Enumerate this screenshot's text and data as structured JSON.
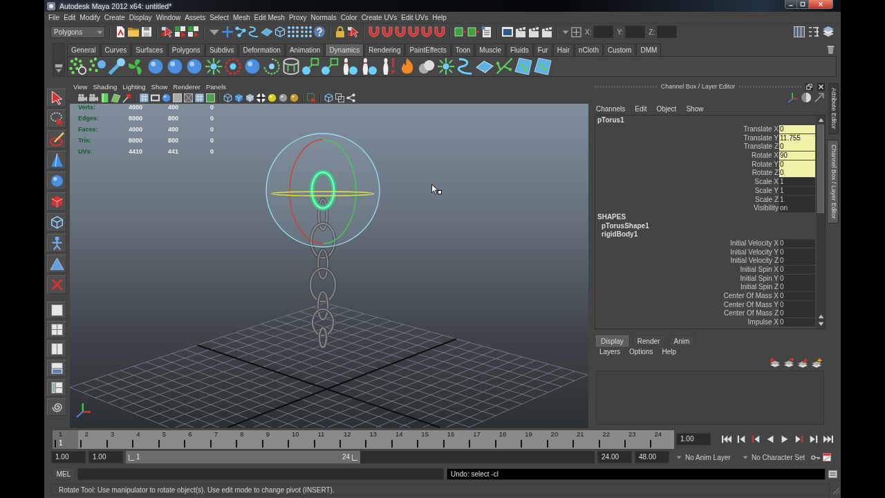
{
  "window": {
    "title": "Autodesk Maya 2012 x64: untitled*"
  },
  "menu_bar": [
    "File",
    "Edit",
    "Modify",
    "Create",
    "Display",
    "Window",
    "Assets",
    "Select",
    "Mesh",
    "Edit Mesh",
    "Proxy",
    "Normals",
    "Color",
    "Create UVs",
    "Edit UVs",
    "Help"
  ],
  "status_line": {
    "menu_set": "Polygons",
    "coordinate_fields": [
      {
        "label": "X:"
      },
      {
        "label": "Y:"
      },
      {
        "label": "Z:"
      }
    ]
  },
  "shelf": {
    "tabs": [
      {
        "label": "General",
        "selected": false
      },
      {
        "label": "Curves",
        "selected": false
      },
      {
        "label": "Surfaces",
        "selected": false
      },
      {
        "label": "Polygons",
        "selected": false
      },
      {
        "label": "Subdivs",
        "selected": false
      },
      {
        "label": "Deformation",
        "selected": false
      },
      {
        "label": "Animation",
        "selected": false
      },
      {
        "label": "Dynamics",
        "selected": true
      },
      {
        "label": "Rendering",
        "selected": false
      },
      {
        "label": "PaintEffects",
        "selected": false
      },
      {
        "label": "Toon",
        "selected": false
      },
      {
        "label": "Muscle",
        "selected": false
      },
      {
        "label": "Fluids",
        "selected": false
      },
      {
        "label": "Fur",
        "selected": false
      },
      {
        "label": "Hair",
        "selected": false
      },
      {
        "label": "nCloth",
        "selected": false
      },
      {
        "label": "Custom",
        "selected": false
      },
      {
        "label": "DMM",
        "selected": false
      }
    ]
  },
  "viewport": {
    "menus": [
      "View",
      "Shading",
      "Lighting",
      "Show",
      "Renderer",
      "Panels"
    ],
    "hud": [
      {
        "label": "Verts:",
        "values": [
          "4000",
          "400",
          "0"
        ]
      },
      {
        "label": "Edges:",
        "values": [
          "8000",
          "800",
          "0"
        ]
      },
      {
        "label": "Faces:",
        "values": [
          "4000",
          "400",
          "0"
        ]
      },
      {
        "label": "Tris:",
        "values": [
          "8000",
          "800",
          "0"
        ]
      },
      {
        "label": "UVs:",
        "values": [
          "4410",
          "441",
          "0"
        ]
      }
    ]
  },
  "channel_box": {
    "title": "Channel Box / Layer Editor",
    "menus": [
      "Channels",
      "Edit",
      "Object",
      "Show"
    ],
    "rows": [
      {
        "kind": "node",
        "name": "pTorus1"
      },
      {
        "kind": "attribute",
        "label": "Translate X",
        "value": "0",
        "connected": true
      },
      {
        "kind": "attribute",
        "label": "Translate Y",
        "value": "11.755",
        "connected": true
      },
      {
        "kind": "attribute",
        "label": "Translate Z",
        "value": "0",
        "connected": true
      },
      {
        "kind": "attribute",
        "label": "Rotate X",
        "value": "90",
        "connected": true
      },
      {
        "kind": "attribute",
        "label": "Rotate Y",
        "value": "0",
        "connected": true
      },
      {
        "kind": "attribute",
        "label": "Rotate Z",
        "value": "0",
        "connected": true
      },
      {
        "kind": "attribute",
        "label": "Scale X",
        "value": "1",
        "connected": false
      },
      {
        "kind": "attribute",
        "label": "Scale Y",
        "value": "1",
        "connected": false
      },
      {
        "kind": "attribute",
        "label": "Scale Z",
        "value": "1",
        "connected": false
      },
      {
        "kind": "attribute",
        "label": "Visibility",
        "value": "on",
        "connected": false
      },
      {
        "kind": "heading",
        "name": "SHAPES"
      },
      {
        "kind": "shape",
        "name": "pTorusShape1"
      },
      {
        "kind": "shape",
        "name": "rigidBody1"
      },
      {
        "kind": "attribute",
        "label": "Initial Velocity X",
        "value": "0",
        "connected": false
      },
      {
        "kind": "attribute",
        "label": "Initial Velocity Y",
        "value": "0",
        "connected": false
      },
      {
        "kind": "attribute",
        "label": "Initial Velocity Z",
        "value": "0",
        "connected": false
      },
      {
        "kind": "attribute",
        "label": "Initial Spin X",
        "value": "0",
        "connected": false
      },
      {
        "kind": "attribute",
        "label": "Initial Spin Y",
        "value": "0",
        "connected": false
      },
      {
        "kind": "attribute",
        "label": "Initial Spin Z",
        "value": "0",
        "connected": false
      },
      {
        "kind": "attribute",
        "label": "Center Of Mass X",
        "value": "0",
        "connected": false
      },
      {
        "kind": "attribute",
        "label": "Center Of Mass Y",
        "value": "0",
        "connected": false
      },
      {
        "kind": "attribute",
        "label": "Center Of Mass Z",
        "value": "0",
        "connected": false
      },
      {
        "kind": "attribute",
        "label": "Impulse X",
        "value": "0",
        "connected": false
      }
    ]
  },
  "layer_editor": {
    "tabs": [
      {
        "label": "Display",
        "selected": true
      },
      {
        "label": "Render",
        "selected": false
      },
      {
        "label": "Anim",
        "selected": false
      }
    ],
    "menus": [
      "Layers",
      "Options",
      "Help"
    ]
  },
  "side_tabs": [
    {
      "label": "Attribute Editor",
      "selected": false
    },
    {
      "label": "Channel Box / Layer Editor",
      "selected": true
    }
  ],
  "time_slider": {
    "frames": [
      {
        "label": "1",
        "selected": true
      },
      {
        "label": "2",
        "selected": false
      },
      {
        "label": "3",
        "selected": false
      },
      {
        "label": "4",
        "selected": false
      },
      {
        "label": "5",
        "selected": false
      },
      {
        "label": "6",
        "selected": false
      },
      {
        "label": "7",
        "selected": false
      },
      {
        "label": "8",
        "selected": false
      },
      {
        "label": "9",
        "selected": false
      },
      {
        "label": "10",
        "selected": false
      },
      {
        "label": "11",
        "selected": false
      },
      {
        "label": "12",
        "selected": false
      },
      {
        "label": "13",
        "selected": false
      },
      {
        "label": "14",
        "selected": false
      },
      {
        "label": "15",
        "selected": false
      },
      {
        "label": "16",
        "selected": false
      },
      {
        "label": "17",
        "selected": false
      },
      {
        "label": "18",
        "selected": false
      },
      {
        "label": "19",
        "selected": false
      },
      {
        "label": "20",
        "selected": false
      },
      {
        "label": "21",
        "selected": false
      },
      {
        "label": "22",
        "selected": false
      },
      {
        "label": "23",
        "selected": false
      },
      {
        "label": "24",
        "selected": false
      }
    ],
    "current_frame": "1",
    "current_time": "1.00"
  },
  "range_slider": {
    "start_time": "1.00",
    "playback_start": "1.00",
    "range_start": "1",
    "range_end": "24",
    "level": 0.5,
    "playback_end": "24.00",
    "end_time": "48.00"
  },
  "anim_layer": "No Anim Layer",
  "character_set": "No Character Set",
  "command_line": {
    "language": "MEL",
    "result": "Undo: select -cl"
  },
  "help_line": "Rotate Tool: Use manipulator to rotate object(s). Use edit mode to change pivot (INSERT)."
}
